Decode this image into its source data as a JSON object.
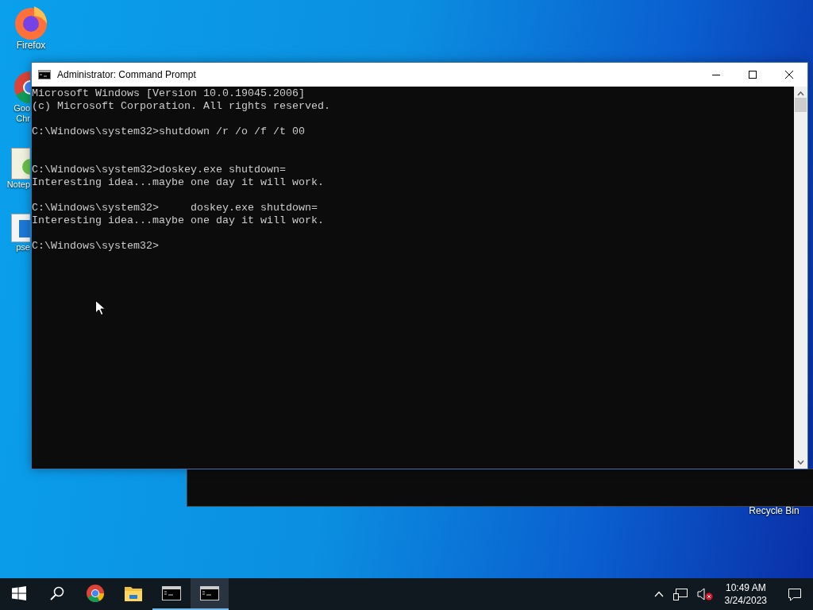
{
  "desktop_icons": [
    {
      "kind": "firefox",
      "label_lines": [
        "Firefox"
      ]
    }
  ],
  "partly_hidden_desktop_icons": [
    {
      "kind": "chrome",
      "label_lines": [
        "Goo",
        "Chr"
      ]
    },
    {
      "kind": "notepad",
      "label_lines": [
        "Notep"
      ]
    },
    {
      "kind": "document",
      "label_lines": [
        "pse"
      ]
    }
  ],
  "recycle_bin": {
    "label": "Recycle Bin"
  },
  "window": {
    "title": "Administrator:  Command Prompt",
    "controls": [
      {
        "kind": "minimize"
      },
      {
        "kind": "maximize"
      },
      {
        "kind": "close"
      }
    ]
  },
  "console": {
    "lines": [
      {
        "kind": "text",
        "text": "Microsoft Windows [Version 10.0.19045.2006]"
      },
      {
        "kind": "text",
        "text": "(c) Microsoft Corporation. All rights reserved."
      },
      {
        "kind": "blank"
      },
      {
        "kind": "text",
        "text": "C:\\Windows\\system32>shutdown /r /o /f /t 00"
      },
      {
        "kind": "blank"
      },
      {
        "kind": "blank"
      },
      {
        "kind": "text",
        "text": "C:\\Windows\\system32>doskey.exe shutdown="
      },
      {
        "kind": "text",
        "text": "Interesting idea...maybe one day it will work."
      },
      {
        "kind": "blank"
      },
      {
        "kind": "text",
        "text": "C:\\Windows\\system32>     doskey.exe shutdown="
      },
      {
        "kind": "text",
        "text": "Interesting idea...maybe one day it will work."
      },
      {
        "kind": "blank"
      },
      {
        "kind": "text",
        "text": "C:\\Windows\\system32>"
      }
    ]
  },
  "taskbar": {
    "apps": [
      {
        "kind": "start",
        "selected": false
      },
      {
        "kind": "search",
        "selected": false
      },
      {
        "kind": "chrome",
        "selected": false
      },
      {
        "kind": "explorer",
        "selected": false
      },
      {
        "kind": "console",
        "selected": false
      },
      {
        "kind": "console",
        "selected": true
      }
    ],
    "tray": {
      "time": "10:49 AM",
      "date": "3/24/2023",
      "volume_muted": true
    }
  }
}
